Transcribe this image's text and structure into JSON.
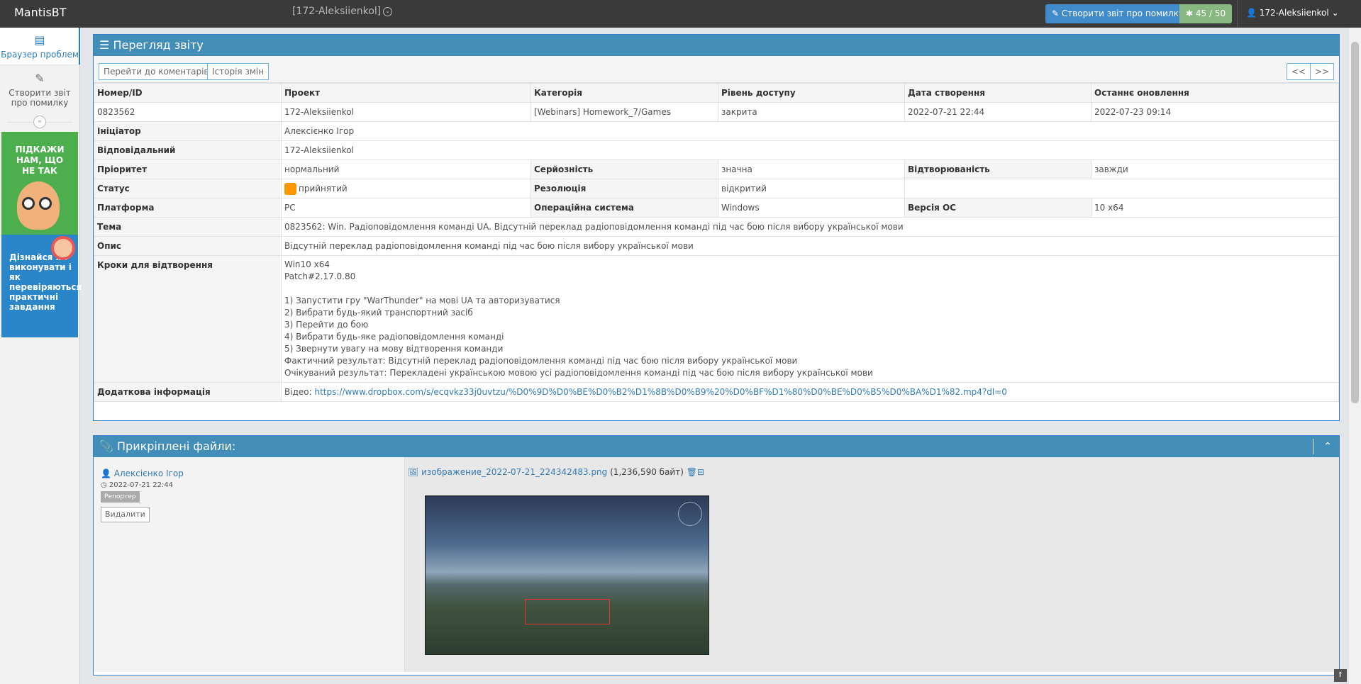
{
  "navbar": {
    "brand": "MantisBT",
    "project_selector": "[172-Aleksiienkol]",
    "report_button": "Створити звіт про помилку",
    "counter": "45 / 50",
    "user": "172-Aleksiienkol"
  },
  "sidebar": {
    "items": [
      {
        "label": "Браузер проблем",
        "icon": "list-icon"
      },
      {
        "label": "Створити звіт про помилку",
        "icon": "edit-icon"
      }
    ],
    "banner1": "ПІДКАЖИ НАМ, ЩО НЕ ТАК",
    "banner2": "Дізнайся як виконувати і як перевіряються практичні завдання"
  },
  "view": {
    "title": "Перегляд звіту",
    "btn_comments": "Перейти до коментарів",
    "btn_history": "Історія змін",
    "btn_prev": "<<",
    "btn_next": ">>",
    "headers": [
      "Номер/ID",
      "Проект",
      "Категорія",
      "Рівень доступу",
      "Дата створення",
      "Останнє оновлення"
    ],
    "row1": [
      "0823562",
      "172-Aleksiienkol",
      "[Webinars] Homework_7/Games",
      "закрита",
      "2022-07-21 22:44",
      "2022-07-23 09:14"
    ],
    "reporter_label": "Ініціатор",
    "reporter": "Алексієнко Ігор",
    "handler_label": "Відповідальний",
    "handler": "172-Aleksiienkol",
    "priority_label": "Пріоритет",
    "priority": "нормальний",
    "severity_label": "Серйозність",
    "severity": "значна",
    "repro_label": "Відтворюваність",
    "repro": "завжди",
    "status_label": "Статус",
    "status": "прийнятий",
    "status_color": "#ff9800",
    "resolution_label": "Резолюція",
    "resolution": "відкритий",
    "platform_label": "Платформа",
    "platform": "PC",
    "os_label": "Операційна система",
    "os": "Windows",
    "os_ver_label": "Версія ОС",
    "os_ver": "10 x64",
    "summary_label": "Тема",
    "summary": "0823562: Win. Радіоповідомлення команді UA. Відсутній переклад радіоповідомлення команді під час бою після вибору української мови",
    "desc_label": "Опис",
    "desc": "Відсутній переклад радіоповідомлення команді під час бою після вибору української мови",
    "steps_label": "Кроки для відтворення",
    "steps": "Win10 x64\nPatch#2.17.0.80\n\n1) Запустити гру \"WarThunder\" на мові UA та авторизуватися\n2) Вибрати будь-який транспортний засіб\n3) Перейти до бою\n4) Вибрати будь-яке радіоповідомлення команді\n5) Звернути увагу на мову відтворення команди\nФактичний результат: Відсутній переклад радіоповідомлення команді під час бою після вибору української мови\nОчікуваний результат: Перекладені українською мовою усі радіоповідомлення команді під час бою після вибору української мови",
    "additional_label": "Додаткова інформація",
    "additional_prefix": "Відео:",
    "additional_link": "https://www.dropbox.com/s/ecqvkz33j0uvtzu/%D0%9D%D0%BE%D0%B2%D1%8B%D0%B9%20%D0%BF%D1%80%D0%BE%D0%B5%D0%BA%D1%82.mp4?dl=0"
  },
  "attachments": {
    "title": "Прикріплені файли:",
    "author": "Алексієнко Ігор",
    "date": "2022-07-21 22:44",
    "role": "Репортер",
    "delete_label": "Видалити",
    "filename": "изображение_2022-07-21_224342483.png",
    "filesize": "(1,236,590 байт)"
  }
}
